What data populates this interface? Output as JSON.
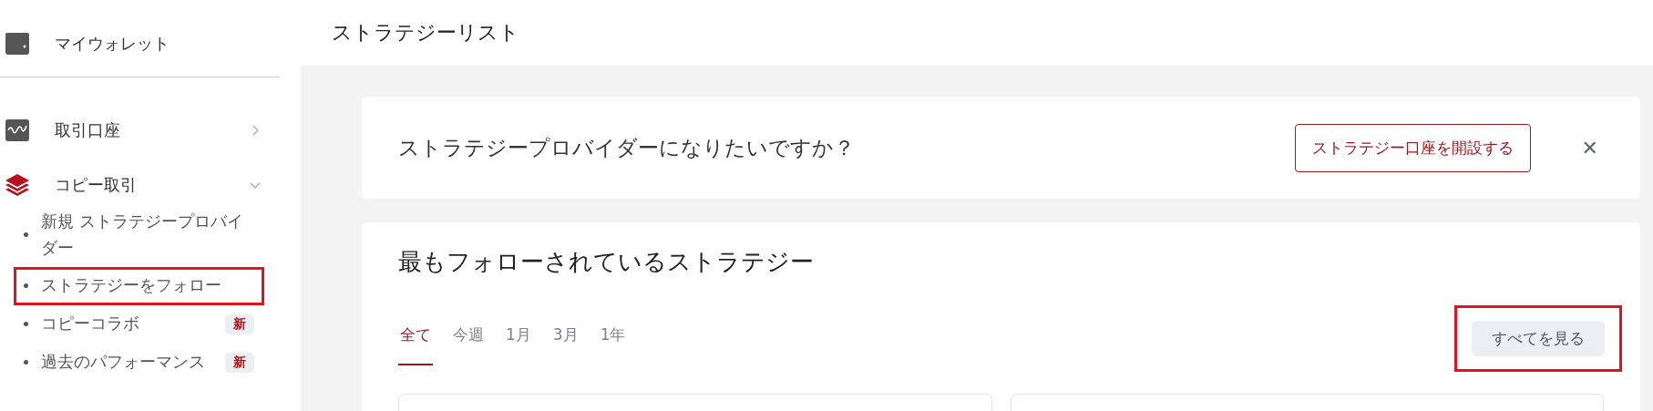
{
  "sidebar": {
    "top_items": [
      {
        "label": "マイウォレット",
        "kind": "wallet"
      }
    ],
    "items": [
      {
        "label": "取引口座",
        "kind": "chart",
        "active": false,
        "expanded": false
      },
      {
        "label": "コピー取引",
        "kind": "layers",
        "active": true,
        "expanded": true,
        "children": [
          {
            "label": "新規 ストラテジープロバイダー",
            "highlighted": false
          },
          {
            "label": "ストラテジーをフォロー",
            "highlighted": true
          },
          {
            "label": "コピーコラボ",
            "badge": "新",
            "highlighted": false
          },
          {
            "label": "過去のパフォーマンス",
            "badge": "新",
            "highlighted": false
          }
        ]
      }
    ]
  },
  "header": {
    "title": "ストラテジーリスト"
  },
  "banner": {
    "text": "ストラテジープロバイダーになりたいですか？",
    "button": "ストラテジー口座を開設する",
    "close": "✕"
  },
  "section": {
    "title": "最もフォローされているストラテジー",
    "tabs": [
      {
        "label": "全て",
        "selected": true
      },
      {
        "label": "今週",
        "selected": false
      },
      {
        "label": "1月",
        "selected": false
      },
      {
        "label": "3月",
        "selected": false
      },
      {
        "label": "1年",
        "selected": false
      }
    ],
    "view_all": {
      "label": "すべてを見る",
      "highlighted": true
    }
  }
}
